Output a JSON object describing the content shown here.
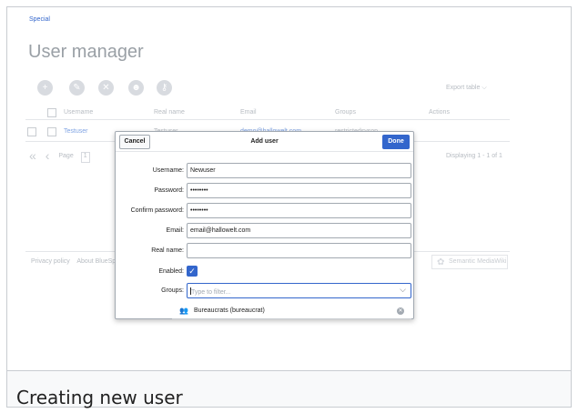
{
  "breadcrumb": "Special",
  "page_title": "User manager",
  "toolbar": {
    "icons": [
      "add-icon",
      "wrench-icon",
      "remove-icon",
      "group-icon",
      "key-icon"
    ],
    "export_label": "Export table"
  },
  "table": {
    "columns": [
      "Username",
      "Real name",
      "Email",
      "Groups",
      "Actions"
    ],
    "rows": [
      {
        "username": "Testuser",
        "realname": "Testuser",
        "email": "demo@hallowelt.com",
        "groups": "restrictedsysop"
      }
    ]
  },
  "pager": {
    "page_label": "Page",
    "page_value": "1",
    "display_text": "Displaying 1 - 1 of 1"
  },
  "footer": {
    "links": [
      "Privacy policy",
      "About BlueSpi"
    ],
    "badge": "Semantic MediaWiki"
  },
  "dialog": {
    "title": "Add user",
    "cancel_label": "Cancel",
    "done_label": "Done",
    "fields": {
      "username": {
        "label": "Username:",
        "value": "Newuser"
      },
      "password": {
        "label": "Password:",
        "value": "••••••••"
      },
      "confirm": {
        "label": "Confirm password:",
        "value": "••••••••"
      },
      "email": {
        "label": "Email:",
        "value": "email@hallowelt.com"
      },
      "realname": {
        "label": "Real name:",
        "value": ""
      },
      "enabled": {
        "label": "Enabled:",
        "checked": true
      },
      "groups": {
        "label": "Groups:",
        "placeholder": "Type to filter..."
      }
    },
    "selected_group": "Bureaucrats (bureaucrat)"
  },
  "caption": "Creating new user",
  "colors": {
    "accent": "#3366cc",
    "border": "#a2a9b1"
  }
}
